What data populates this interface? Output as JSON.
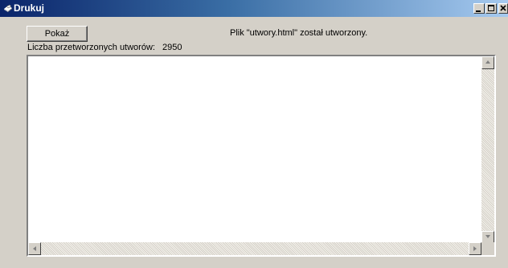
{
  "window": {
    "title": "Drukuj",
    "icon": "printer-icon",
    "controls": [
      "minimize-icon",
      "maximize-icon",
      "close-icon"
    ]
  },
  "toolbar": {
    "show_label": "Pokaż"
  },
  "status": {
    "message": "Plik \"utwory.html\" został utworzony."
  },
  "stats": {
    "processed_label": "Liczba przetworzonych utworów:",
    "processed_value": "2950"
  },
  "output": {
    "text": ""
  }
}
